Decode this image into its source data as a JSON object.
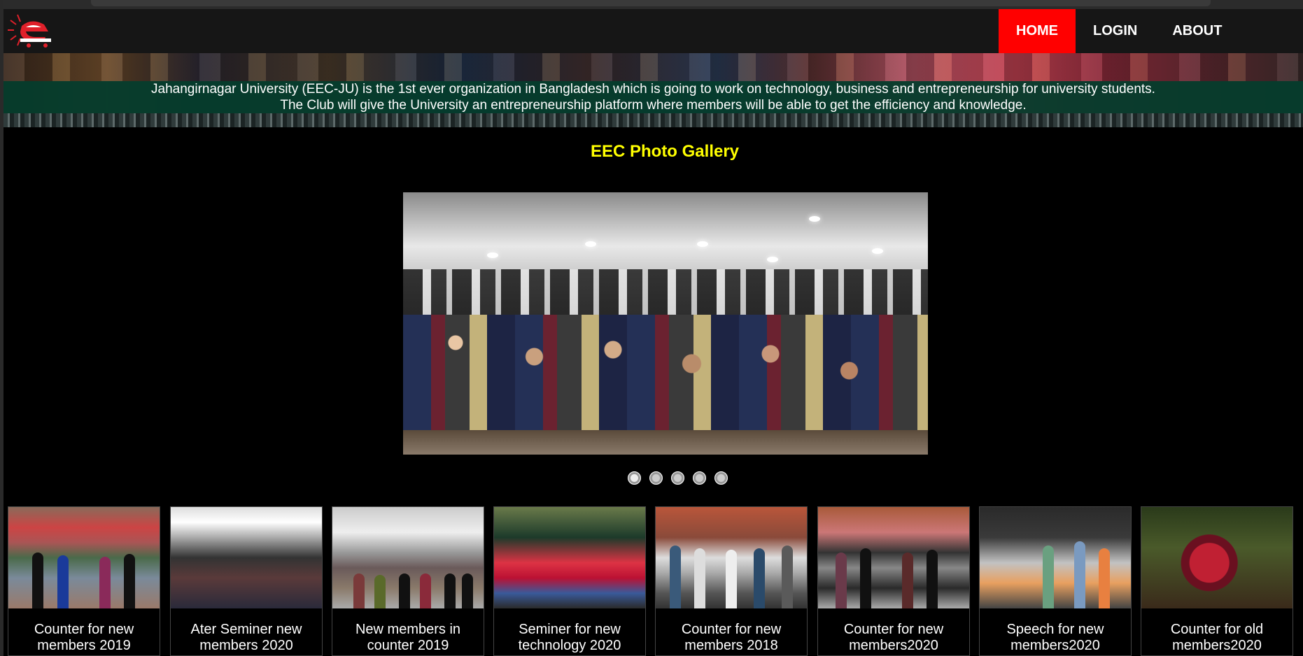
{
  "nav": {
    "logo_alt": "EEC logo",
    "items": [
      {
        "label": "HOME",
        "active": true
      },
      {
        "label": "LOGIN",
        "active": false
      },
      {
        "label": "ABOUT",
        "active": false
      }
    ]
  },
  "banner": {
    "line1": "Jahangirnagar University (EEC-JU) is the 1st ever organization in Bangladesh which is going to work on technology, business and entrepreneurship for university students.",
    "line2": "The Club will give the University an entrepreneurship platform where members will be able to get the efficiency and knowledge."
  },
  "gallery": {
    "title": "EEC Photo Gallery",
    "slide_count": 5,
    "active_slide": 1
  },
  "thumbnails": [
    {
      "caption": "Counter for new members 2019"
    },
    {
      "caption": "Ater Seminer new members 2020"
    },
    {
      "caption": "New members in counter 2019"
    },
    {
      "caption": "Seminer for new technology 2020"
    },
    {
      "caption": "Counter for new members 2018"
    },
    {
      "caption": "Counter for new members2020"
    },
    {
      "caption": "Speech for new members2020"
    },
    {
      "caption": "Counter for old members2020"
    }
  ],
  "colors": {
    "active_nav": "#ff0000",
    "title": "#ffff00",
    "banner_strip": "#043c2c"
  }
}
